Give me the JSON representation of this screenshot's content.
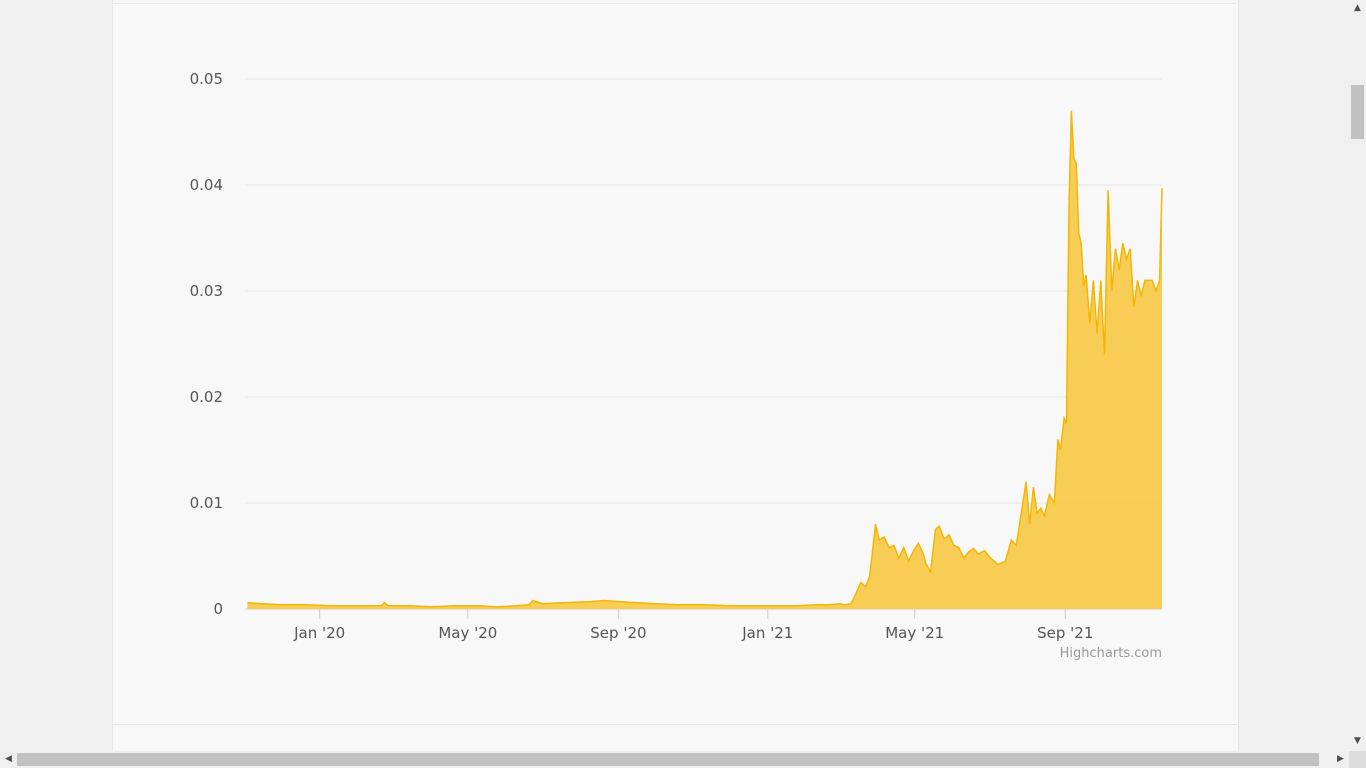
{
  "chart_data": {
    "type": "area",
    "title": "",
    "xlabel": "",
    "ylabel": "",
    "credits": "Highcharts.com",
    "color": "#f8c53a",
    "line_color": "#f2b705",
    "grid": true,
    "legend": "none",
    "x_range": [
      "2019-11-01",
      "2021-11-19"
    ],
    "ylim": [
      0,
      0.05
    ],
    "y_ticks": [
      0,
      0.01,
      0.02,
      0.03,
      0.04,
      0.05
    ],
    "y_tick_labels": [
      "0",
      "0.01",
      "0.02",
      "0.03",
      "0.04",
      "0.05"
    ],
    "x_ticks": [
      "2020-01-01",
      "2020-05-01",
      "2020-09-01",
      "2021-01-01",
      "2021-05-01",
      "2021-09-01"
    ],
    "x_tick_labels": [
      "Jan '20",
      "May '20",
      "Sep '20",
      "Jan '21",
      "May '21",
      "Sep '21"
    ],
    "series": [
      {
        "x": [
          "2019-11-03",
          "2019-11-15",
          "2019-12-01",
          "2019-12-20",
          "2020-01-10",
          "2020-02-01",
          "2020-02-20",
          "2020-02-23",
          "2020-02-26",
          "2020-03-15",
          "2020-04-01",
          "2020-04-20",
          "2020-05-10",
          "2020-05-25",
          "2020-06-10",
          "2020-06-20",
          "2020-06-23",
          "2020-07-01",
          "2020-07-20",
          "2020-08-10",
          "2020-08-20",
          "2020-09-01",
          "2020-09-15",
          "2020-10-01",
          "2020-10-20",
          "2020-11-10",
          "2020-12-01",
          "2020-12-20",
          "2021-01-10",
          "2021-01-25",
          "2021-02-10",
          "2021-02-20",
          "2021-03-01",
          "2021-03-05",
          "2021-03-10",
          "2021-03-13",
          "2021-03-18",
          "2021-03-22",
          "2021-03-25",
          "2021-03-27",
          "2021-03-30",
          "2021-04-02",
          "2021-04-06",
          "2021-04-10",
          "2021-04-14",
          "2021-04-18",
          "2021-04-22",
          "2021-04-26",
          "2021-04-30",
          "2021-05-04",
          "2021-05-08",
          "2021-05-10",
          "2021-05-14",
          "2021-05-18",
          "2021-05-21",
          "2021-05-25",
          "2021-05-29",
          "2021-06-02",
          "2021-06-06",
          "2021-06-10",
          "2021-06-14",
          "2021-06-18",
          "2021-06-22",
          "2021-06-27",
          "2021-07-02",
          "2021-07-08",
          "2021-07-14",
          "2021-07-19",
          "2021-07-23",
          "2021-07-27",
          "2021-07-31",
          "2021-08-03",
          "2021-08-06",
          "2021-08-09",
          "2021-08-12",
          "2021-08-15",
          "2021-08-19",
          "2021-08-23",
          "2021-08-26",
          "2021-08-28",
          "2021-08-31",
          "2021-09-02",
          "2021-09-04",
          "2021-09-06",
          "2021-09-08",
          "2021-09-10",
          "2021-09-12",
          "2021-09-14",
          "2021-09-16",
          "2021-09-18",
          "2021-09-21",
          "2021-09-24",
          "2021-09-27",
          "2021-09-30",
          "2021-10-03",
          "2021-10-06",
          "2021-10-09",
          "2021-10-12",
          "2021-10-15",
          "2021-10-18",
          "2021-10-21",
          "2021-10-24",
          "2021-10-27",
          "2021-10-30",
          "2021-11-02",
          "2021-11-05",
          "2021-11-08",
          "2021-11-11",
          "2021-11-14",
          "2021-11-17",
          "2021-11-19"
        ],
        "y": [
          0.0006,
          0.0005,
          0.0004,
          0.0004,
          0.0003,
          0.0003,
          0.0003,
          0.0006,
          0.0003,
          0.0003,
          0.0002,
          0.0003,
          0.0003,
          0.0002,
          0.0003,
          0.0004,
          0.0008,
          0.0005,
          0.0006,
          0.0007,
          0.0008,
          0.0007,
          0.0006,
          0.0005,
          0.0004,
          0.0004,
          0.0003,
          0.0003,
          0.0003,
          0.0003,
          0.0004,
          0.0004,
          0.0005,
          0.0004,
          0.0005,
          0.0012,
          0.0025,
          0.0021,
          0.003,
          0.0048,
          0.008,
          0.0065,
          0.0068,
          0.0058,
          0.006,
          0.0048,
          0.0058,
          0.0045,
          0.0055,
          0.0062,
          0.0052,
          0.0043,
          0.0035,
          0.0075,
          0.0078,
          0.0066,
          0.007,
          0.006,
          0.0058,
          0.0048,
          0.0054,
          0.0057,
          0.0052,
          0.0055,
          0.0048,
          0.0042,
          0.0045,
          0.0065,
          0.006,
          0.009,
          0.012,
          0.008,
          0.0115,
          0.009,
          0.0095,
          0.0088,
          0.0108,
          0.01,
          0.016,
          0.015,
          0.018,
          0.0175,
          0.038,
          0.047,
          0.0425,
          0.042,
          0.0355,
          0.0345,
          0.0305,
          0.0315,
          0.027,
          0.031,
          0.026,
          0.031,
          0.024,
          0.0395,
          0.03,
          0.034,
          0.032,
          0.0345,
          0.033,
          0.034,
          0.0285,
          0.031,
          0.0295,
          0.031,
          0.031,
          0.031,
          0.03,
          0.031,
          0.0397
        ]
      }
    ]
  }
}
